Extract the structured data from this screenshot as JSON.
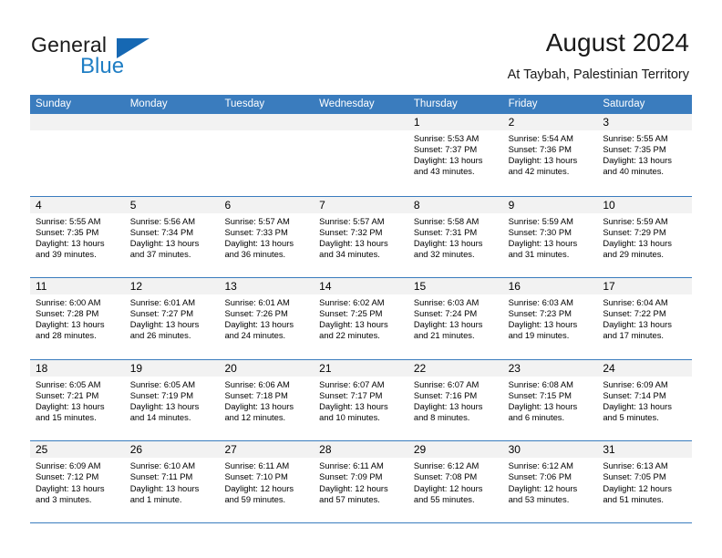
{
  "brand": {
    "name_top": "General",
    "name_bottom": "Blue",
    "triangle_color": "#1668b3",
    "blue_color": "#1f7ec4"
  },
  "header": {
    "title": "August 2024",
    "subtitle": "At Taybah, Palestinian Territory"
  },
  "theme": {
    "header_blue": "#3a7cbe",
    "daynum_bg": "#f2f2f2",
    "text": "#000000"
  },
  "weekdays": [
    "Sunday",
    "Monday",
    "Tuesday",
    "Wednesday",
    "Thursday",
    "Friday",
    "Saturday"
  ],
  "weeks": [
    [
      {
        "day": "",
        "empty": true
      },
      {
        "day": "",
        "empty": true
      },
      {
        "day": "",
        "empty": true
      },
      {
        "day": "",
        "empty": true
      },
      {
        "day": "1",
        "sunrise": "Sunrise: 5:53 AM",
        "sunset": "Sunset: 7:37 PM",
        "daylight_1": "Daylight: 13 hours",
        "daylight_2": "and 43 minutes."
      },
      {
        "day": "2",
        "sunrise": "Sunrise: 5:54 AM",
        "sunset": "Sunset: 7:36 PM",
        "daylight_1": "Daylight: 13 hours",
        "daylight_2": "and 42 minutes."
      },
      {
        "day": "3",
        "sunrise": "Sunrise: 5:55 AM",
        "sunset": "Sunset: 7:35 PM",
        "daylight_1": "Daylight: 13 hours",
        "daylight_2": "and 40 minutes."
      }
    ],
    [
      {
        "day": "4",
        "sunrise": "Sunrise: 5:55 AM",
        "sunset": "Sunset: 7:35 PM",
        "daylight_1": "Daylight: 13 hours",
        "daylight_2": "and 39 minutes."
      },
      {
        "day": "5",
        "sunrise": "Sunrise: 5:56 AM",
        "sunset": "Sunset: 7:34 PM",
        "daylight_1": "Daylight: 13 hours",
        "daylight_2": "and 37 minutes."
      },
      {
        "day": "6",
        "sunrise": "Sunrise: 5:57 AM",
        "sunset": "Sunset: 7:33 PM",
        "daylight_1": "Daylight: 13 hours",
        "daylight_2": "and 36 minutes."
      },
      {
        "day": "7",
        "sunrise": "Sunrise: 5:57 AM",
        "sunset": "Sunset: 7:32 PM",
        "daylight_1": "Daylight: 13 hours",
        "daylight_2": "and 34 minutes."
      },
      {
        "day": "8",
        "sunrise": "Sunrise: 5:58 AM",
        "sunset": "Sunset: 7:31 PM",
        "daylight_1": "Daylight: 13 hours",
        "daylight_2": "and 32 minutes."
      },
      {
        "day": "9",
        "sunrise": "Sunrise: 5:59 AM",
        "sunset": "Sunset: 7:30 PM",
        "daylight_1": "Daylight: 13 hours",
        "daylight_2": "and 31 minutes."
      },
      {
        "day": "10",
        "sunrise": "Sunrise: 5:59 AM",
        "sunset": "Sunset: 7:29 PM",
        "daylight_1": "Daylight: 13 hours",
        "daylight_2": "and 29 minutes."
      }
    ],
    [
      {
        "day": "11",
        "sunrise": "Sunrise: 6:00 AM",
        "sunset": "Sunset: 7:28 PM",
        "daylight_1": "Daylight: 13 hours",
        "daylight_2": "and 28 minutes."
      },
      {
        "day": "12",
        "sunrise": "Sunrise: 6:01 AM",
        "sunset": "Sunset: 7:27 PM",
        "daylight_1": "Daylight: 13 hours",
        "daylight_2": "and 26 minutes."
      },
      {
        "day": "13",
        "sunrise": "Sunrise: 6:01 AM",
        "sunset": "Sunset: 7:26 PM",
        "daylight_1": "Daylight: 13 hours",
        "daylight_2": "and 24 minutes."
      },
      {
        "day": "14",
        "sunrise": "Sunrise: 6:02 AM",
        "sunset": "Sunset: 7:25 PM",
        "daylight_1": "Daylight: 13 hours",
        "daylight_2": "and 22 minutes."
      },
      {
        "day": "15",
        "sunrise": "Sunrise: 6:03 AM",
        "sunset": "Sunset: 7:24 PM",
        "daylight_1": "Daylight: 13 hours",
        "daylight_2": "and 21 minutes."
      },
      {
        "day": "16",
        "sunrise": "Sunrise: 6:03 AM",
        "sunset": "Sunset: 7:23 PM",
        "daylight_1": "Daylight: 13 hours",
        "daylight_2": "and 19 minutes."
      },
      {
        "day": "17",
        "sunrise": "Sunrise: 6:04 AM",
        "sunset": "Sunset: 7:22 PM",
        "daylight_1": "Daylight: 13 hours",
        "daylight_2": "and 17 minutes."
      }
    ],
    [
      {
        "day": "18",
        "sunrise": "Sunrise: 6:05 AM",
        "sunset": "Sunset: 7:21 PM",
        "daylight_1": "Daylight: 13 hours",
        "daylight_2": "and 15 minutes."
      },
      {
        "day": "19",
        "sunrise": "Sunrise: 6:05 AM",
        "sunset": "Sunset: 7:19 PM",
        "daylight_1": "Daylight: 13 hours",
        "daylight_2": "and 14 minutes."
      },
      {
        "day": "20",
        "sunrise": "Sunrise: 6:06 AM",
        "sunset": "Sunset: 7:18 PM",
        "daylight_1": "Daylight: 13 hours",
        "daylight_2": "and 12 minutes."
      },
      {
        "day": "21",
        "sunrise": "Sunrise: 6:07 AM",
        "sunset": "Sunset: 7:17 PM",
        "daylight_1": "Daylight: 13 hours",
        "daylight_2": "and 10 minutes."
      },
      {
        "day": "22",
        "sunrise": "Sunrise: 6:07 AM",
        "sunset": "Sunset: 7:16 PM",
        "daylight_1": "Daylight: 13 hours",
        "daylight_2": "and 8 minutes."
      },
      {
        "day": "23",
        "sunrise": "Sunrise: 6:08 AM",
        "sunset": "Sunset: 7:15 PM",
        "daylight_1": "Daylight: 13 hours",
        "daylight_2": "and 6 minutes."
      },
      {
        "day": "24",
        "sunrise": "Sunrise: 6:09 AM",
        "sunset": "Sunset: 7:14 PM",
        "daylight_1": "Daylight: 13 hours",
        "daylight_2": "and 5 minutes."
      }
    ],
    [
      {
        "day": "25",
        "sunrise": "Sunrise: 6:09 AM",
        "sunset": "Sunset: 7:12 PM",
        "daylight_1": "Daylight: 13 hours",
        "daylight_2": "and 3 minutes."
      },
      {
        "day": "26",
        "sunrise": "Sunrise: 6:10 AM",
        "sunset": "Sunset: 7:11 PM",
        "daylight_1": "Daylight: 13 hours",
        "daylight_2": "and 1 minute."
      },
      {
        "day": "27",
        "sunrise": "Sunrise: 6:11 AM",
        "sunset": "Sunset: 7:10 PM",
        "daylight_1": "Daylight: 12 hours",
        "daylight_2": "and 59 minutes."
      },
      {
        "day": "28",
        "sunrise": "Sunrise: 6:11 AM",
        "sunset": "Sunset: 7:09 PM",
        "daylight_1": "Daylight: 12 hours",
        "daylight_2": "and 57 minutes."
      },
      {
        "day": "29",
        "sunrise": "Sunrise: 6:12 AM",
        "sunset": "Sunset: 7:08 PM",
        "daylight_1": "Daylight: 12 hours",
        "daylight_2": "and 55 minutes."
      },
      {
        "day": "30",
        "sunrise": "Sunrise: 6:12 AM",
        "sunset": "Sunset: 7:06 PM",
        "daylight_1": "Daylight: 12 hours",
        "daylight_2": "and 53 minutes."
      },
      {
        "day": "31",
        "sunrise": "Sunrise: 6:13 AM",
        "sunset": "Sunset: 7:05 PM",
        "daylight_1": "Daylight: 12 hours",
        "daylight_2": "and 51 minutes."
      }
    ]
  ]
}
